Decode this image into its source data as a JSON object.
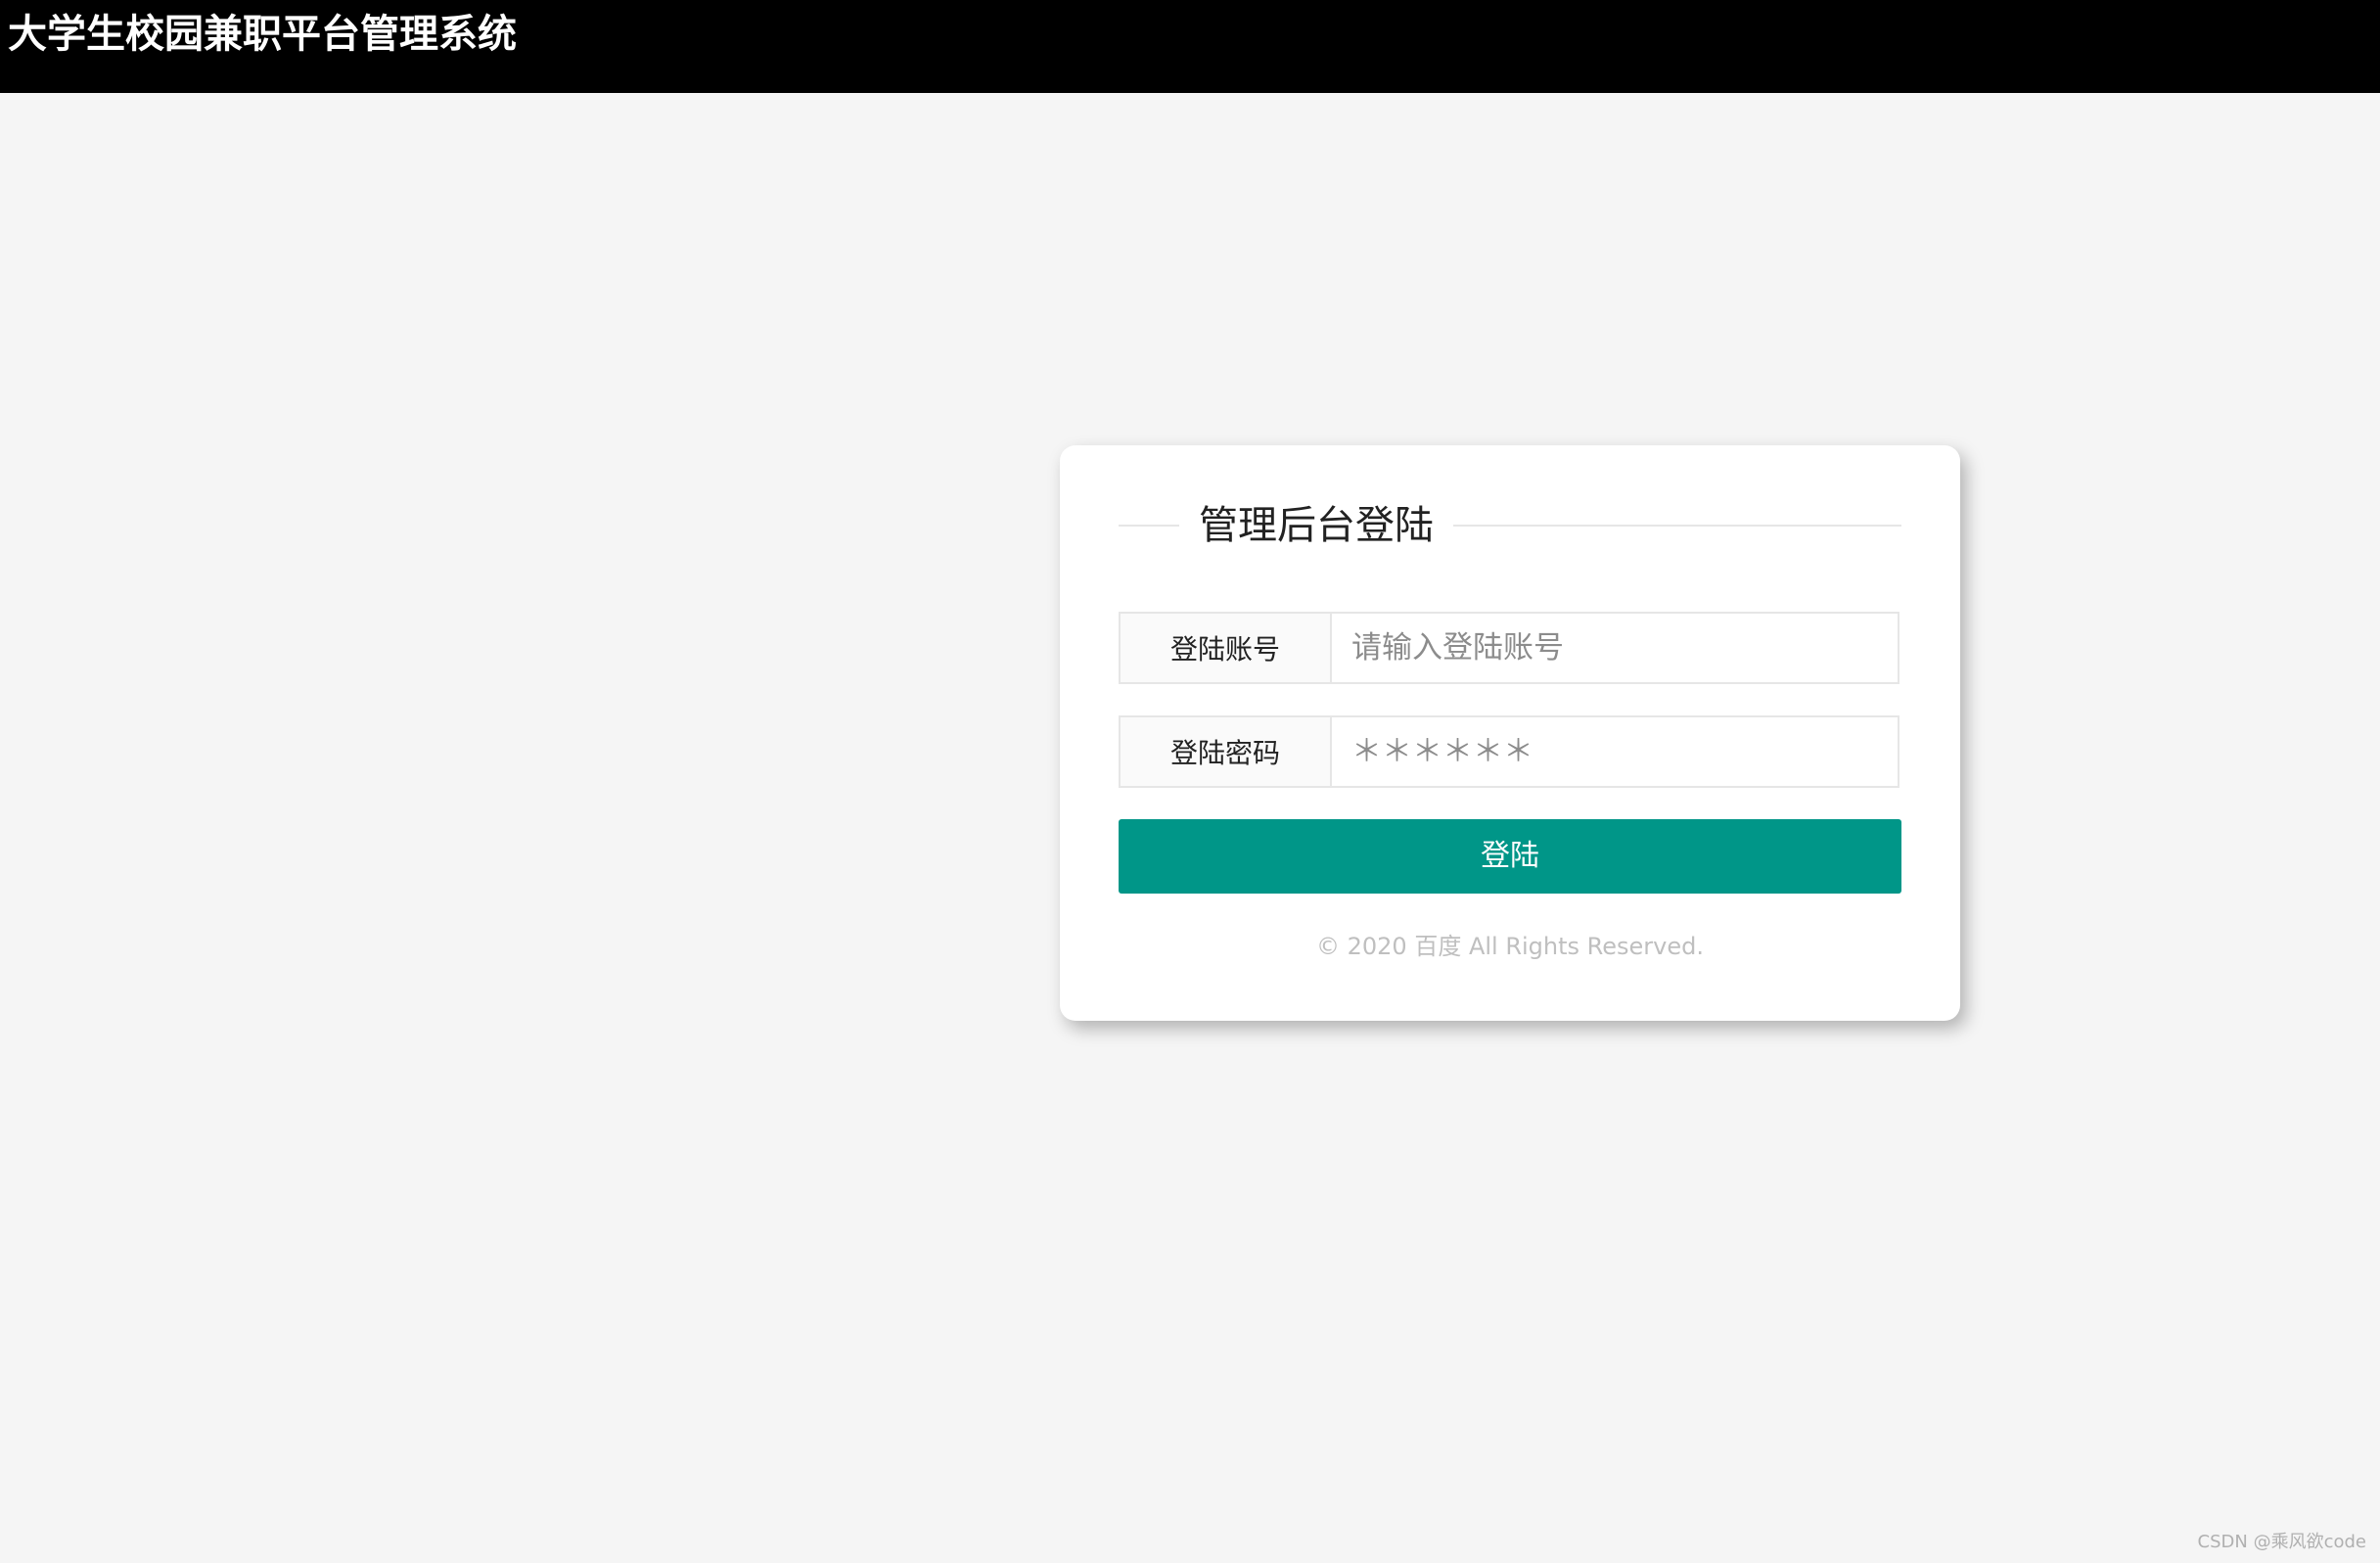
{
  "header": {
    "title": "大学生校园兼职平台管理系统"
  },
  "login": {
    "heading": "管理后台登陆",
    "account": {
      "label": "登陆账号",
      "placeholder": "请输入登陆账号",
      "value": ""
    },
    "password": {
      "label": "登陆密码",
      "placeholder": "＊＊＊＊＊＊",
      "value": ""
    },
    "submit_label": "登陆",
    "copyright": "© 2020 百度 All Rights Reserved."
  },
  "watermark": "CSDN @乘风欲code",
  "colors": {
    "header_bg": "#000000",
    "page_bg": "#f5f5f5",
    "accent": "#009688",
    "card_bg": "#ffffff"
  }
}
